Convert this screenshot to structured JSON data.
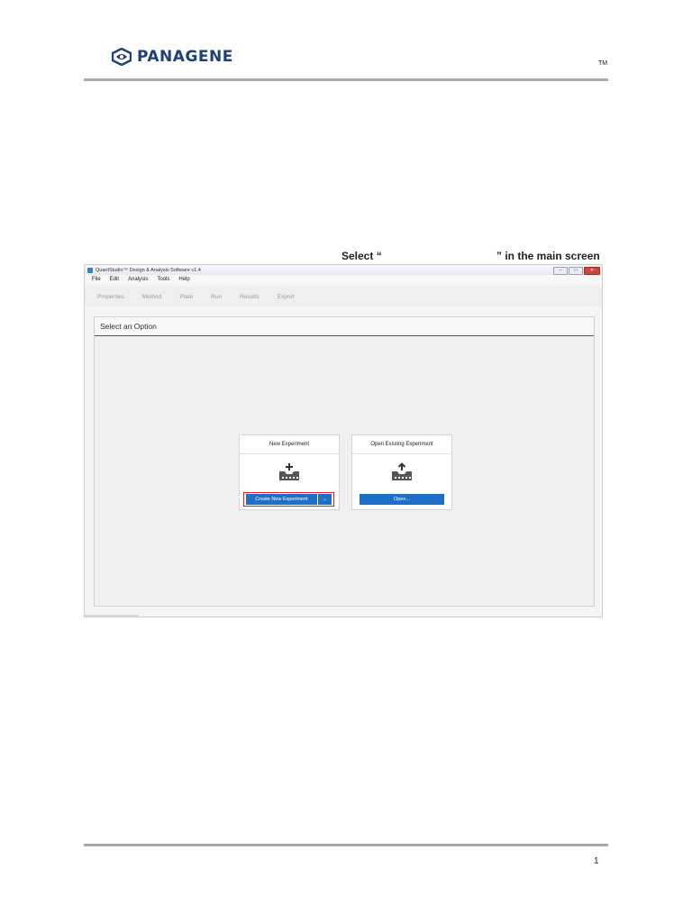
{
  "header": {
    "logo_text": "PANAGENE",
    "trademark": "TM"
  },
  "instruction": {
    "prefix": "Select “",
    "suffix": "” in the main screen"
  },
  "app_window": {
    "title": "QuantStudio™ Design & Analysis Software v1.4",
    "controls": [
      "–",
      "□",
      "✕"
    ],
    "menu": [
      "File",
      "Edit",
      "Analysis",
      "Tools",
      "Help"
    ],
    "toolbar": [
      "Properties",
      "Method",
      "Plate",
      "Run",
      "Results",
      "Export"
    ],
    "panel_title": "Select an Option",
    "cards": {
      "new": {
        "title": "New Experiment",
        "icon": "new-experiment-icon",
        "button": "Create New Experiment",
        "dropdown_arrow": "⌄"
      },
      "open": {
        "title": "Open Existing Experiment",
        "icon": "open-experiment-icon",
        "button": "Open..."
      }
    },
    "colors": {
      "button": "#1e6fc9",
      "highlight": "#e41c1c"
    }
  },
  "footer": {
    "page_number": "1"
  }
}
